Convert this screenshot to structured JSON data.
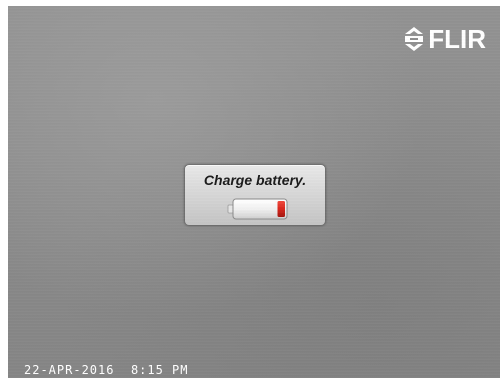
{
  "brand": {
    "logo_text": "FLIR",
    "logo_icon": "flir-emblem-icon"
  },
  "dialog": {
    "message": "Charge battery.",
    "icon": "battery-low-icon",
    "battery_level": 0.15,
    "colors": {
      "low_level": "#d9261c",
      "frame": "#ffffff"
    }
  },
  "status": {
    "date": "22-APR-2016",
    "time": "8:15 PM"
  },
  "colors": {
    "background": "#8d8d8d",
    "overlay_text": "#ffffff"
  }
}
